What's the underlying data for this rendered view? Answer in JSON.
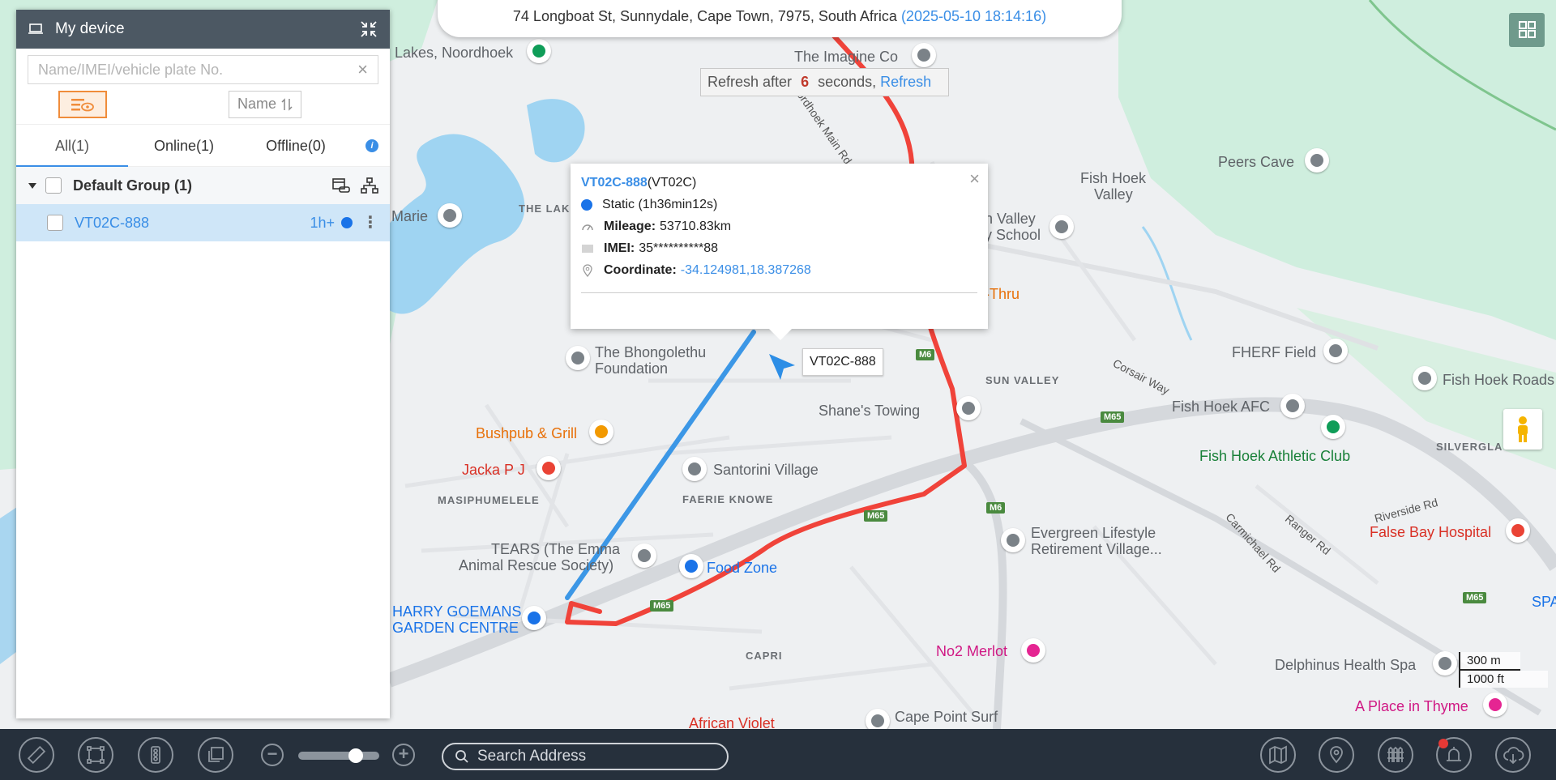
{
  "address_bar": {
    "address": "74 Longboat St, Sunnydale, Cape Town, 7975, South Africa",
    "time": "(2025-05-10 18:14:16)"
  },
  "refresh": {
    "prefix": "Refresh after",
    "count": "6",
    "suffix": "seconds,",
    "link": "Refresh"
  },
  "sidebar": {
    "title": "My device",
    "search_placeholder": "Name/IMEI/vehicle plate No.",
    "sort_label": "Name",
    "tabs": [
      {
        "label": "All(1)"
      },
      {
        "label": "Online(1)"
      },
      {
        "label": "Offline(0)"
      }
    ],
    "group": {
      "label": "Default Group (1)"
    },
    "device": {
      "name": "VT02C-888",
      "time": "1h+"
    }
  },
  "popup": {
    "device_name": "VT02C-888",
    "device_model": "(VT02C)",
    "status": "Static (1h36min12s)",
    "mileage_label": "Mileage:",
    "mileage_value": "53710.83km",
    "imei_label": "IMEI:",
    "imei_value": "35**********88",
    "coord_label": "Coordinate:",
    "coord_value": "-34.124981,18.387268"
  },
  "vehicle_label": "VT02C-888",
  "scale": {
    "metric": "300 m",
    "imperial": "1000 ft"
  },
  "toolbar": {
    "search_placeholder": "Search Address"
  },
  "map_labels": {
    "lakes_noordhoek": "Lakes, Noordhoek",
    "imagine": "The Imagine Co",
    "main_rd": "Noordhoek Main Rd",
    "marie": "Marie",
    "the_lake": "THE LAKE",
    "peers_cave": "Peers Cave",
    "fish_hoek_valley_1": "Fish Hoek",
    "fish_hoek_valley_2": "Valley",
    "valley_school_1": "n Valley",
    "valley_school_2": "y School",
    "thru": "-Thru",
    "bhongolethu_1": "The Bhongolethu",
    "bhongolethu_2": "Foundation",
    "fherf": "FHERF Field",
    "fish_hoek_roads": "Fish Hoek Roads",
    "sun_valley": "SUN VALLEY",
    "corsair": "Corsair Way",
    "shanes": "Shane's Towing",
    "fish_hoek_afc": "Fish Hoek AFC",
    "bushpub": "Bushpub & Grill",
    "athletic": "Fish Hoek Athletic Club",
    "silverglades": "SILVERGLA",
    "jacka": "Jacka P J",
    "santorini": "Santorini Village",
    "faerie": "FAERIE KNOWE",
    "masiphumelele": "MASIPHUMELELE",
    "riverside": "Riverside Rd",
    "tears_1": "TEARS (The Emma",
    "tears_2": "Animal Rescue Society)",
    "food_zone": "Food Zone",
    "evergreen_1": "Evergreen Lifestyle",
    "evergreen_2": "Retirement Village...",
    "ranger": "Ranger Rd",
    "carmichael": "Carmichael Rd",
    "false_bay": "False Bay Hospital",
    "goemans_1": "HARRY GOEMANS",
    "goemans_2": "GARDEN CENTRE",
    "capri": "CAPRI",
    "no2_merlot": "No2 Merlot",
    "delphinus": "Delphinus Health Spa",
    "african_violet": "African Violet",
    "cape_point": "Cape Point Surf",
    "place_thyme": "A Place in Thyme",
    "spa": "SPA",
    "m65_a": "M65",
    "m65_b": "M65",
    "m65_c": "M65",
    "m65_d": "M65",
    "m6_a": "M6",
    "m6_b": "M6"
  },
  "colors": {
    "track_red": "#f0433a",
    "track_blue": "#3c97e6",
    "accent": "#3a8ee6",
    "header": "#4c5863",
    "toolbar": "#26303c",
    "filter_orange": "#f08c3a"
  }
}
